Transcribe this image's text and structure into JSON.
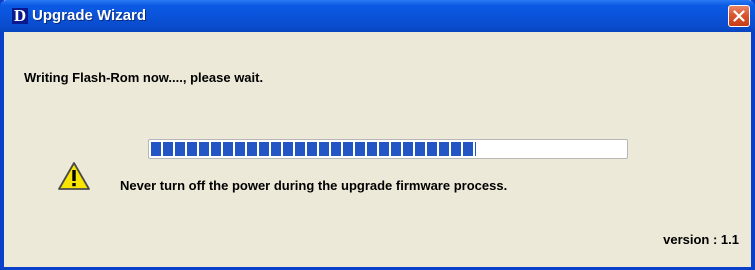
{
  "window": {
    "title": "Upgrade Wizard",
    "logo_letter": "D",
    "close_icon": "close-icon"
  },
  "main": {
    "status_message": "Writing Flash-Rom now...., please wait.",
    "progress_fraction": 0.685,
    "warning_icon": "warning-icon",
    "warning_message": "Never turn off the power during the upgrade firmware process.",
    "version": "version : 1.1"
  },
  "colors": {
    "titlebar": "#0a52d8",
    "window_body": "#ece9d8",
    "progress_block": "#2455c4",
    "close_button": "#d9562f",
    "warning_yellow": "#f7e400"
  }
}
